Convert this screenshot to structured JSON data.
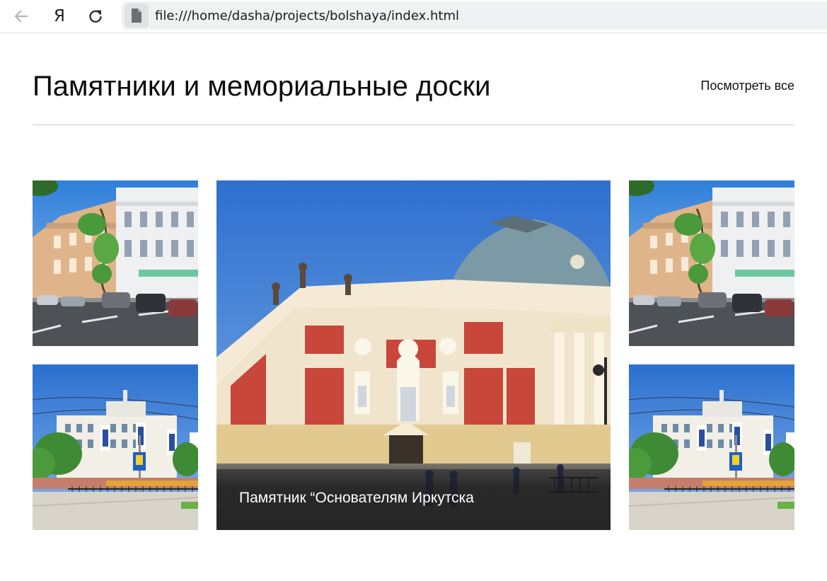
{
  "browser": {
    "url": "file:///home/dasha/projects/bolshaya/index.html",
    "yandex_glyph": "Я",
    "icons": [
      "back-arrow-icon",
      "yandex-icon",
      "reload-icon",
      "page-file-icon"
    ]
  },
  "section": {
    "title": "Памятники и мемориальные доски",
    "view_all_label": "Посмотреть все"
  },
  "gallery": {
    "featured": {
      "caption": "Памятник “Основателям Иркутска"
    },
    "thumbnails": [
      {
        "subject": "street-with-historic-buildings-photo"
      },
      {
        "subject": "building-with-flags-photo"
      },
      {
        "subject": "street-with-historic-buildings-photo"
      },
      {
        "subject": "building-with-flags-photo"
      }
    ]
  },
  "colors": {
    "accent_brick": "#c8463a",
    "sky": "#3f86d8",
    "divider": "#c9c9c9"
  }
}
